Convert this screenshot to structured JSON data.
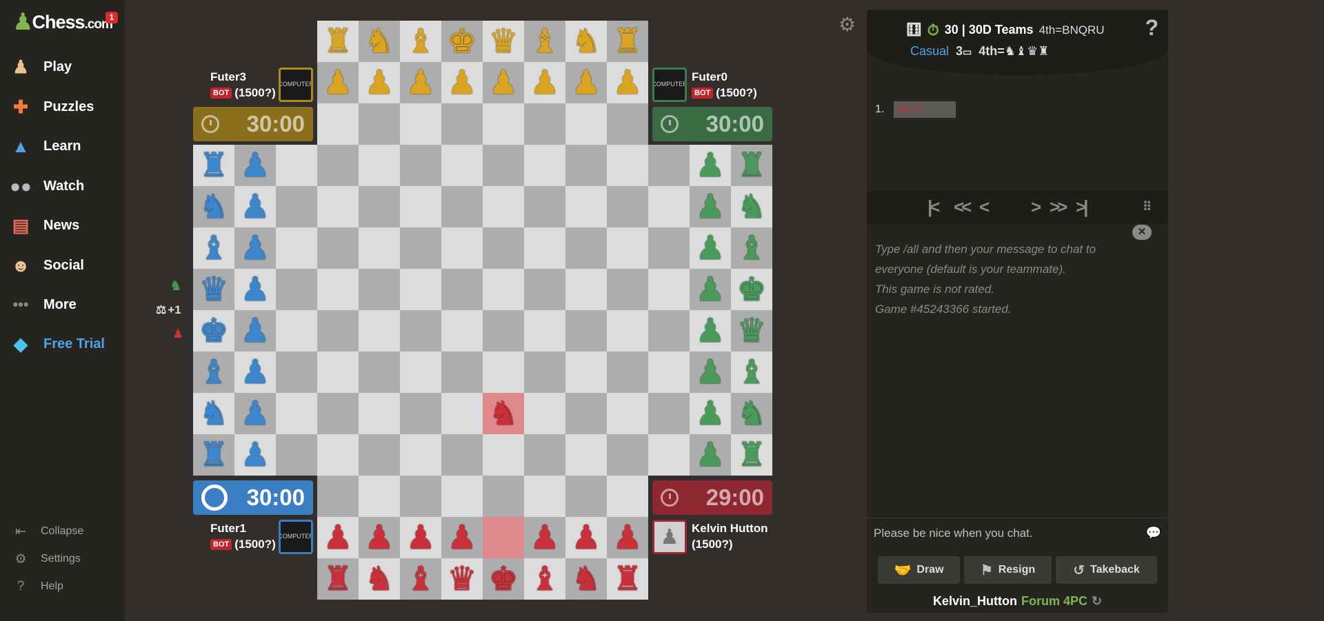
{
  "sidebar": {
    "logo_text": "Chess",
    "logo_suffix": ".com",
    "notification_count": "1",
    "nav": [
      {
        "label": "Play",
        "icon": "play-pawn-icon"
      },
      {
        "label": "Puzzles",
        "icon": "puzzle-icon"
      },
      {
        "label": "Learn",
        "icon": "graduation-cap-icon"
      },
      {
        "label": "Watch",
        "icon": "binoculars-icon"
      },
      {
        "label": "News",
        "icon": "newspaper-icon"
      },
      {
        "label": "Social",
        "icon": "people-icon"
      },
      {
        "label": "More",
        "icon": "more-dots-icon"
      },
      {
        "label": "Free Trial",
        "icon": "diamond-icon"
      }
    ],
    "footer": [
      {
        "label": "Collapse",
        "icon": "collapse-icon"
      },
      {
        "label": "Settings",
        "icon": "gear-icon"
      },
      {
        "label": "Help",
        "icon": "help-icon"
      }
    ]
  },
  "players": {
    "yellow": {
      "name": "Futer3",
      "badge": "BOT",
      "rating": "(1500?)",
      "clock": "30:00",
      "color": "#b08a1c",
      "avatar_text": "COMPUTER"
    },
    "green": {
      "name": "Futer0",
      "badge": "BOT",
      "rating": "(1500?)",
      "clock": "30:00",
      "color": "#3f7a4a",
      "avatar_text": "COMPUTER"
    },
    "blue": {
      "name": "Futer1",
      "badge": "BOT",
      "rating": "(1500?)",
      "clock": "30:00",
      "color": "#3a7fc4",
      "avatar_text": "COMPUTER"
    },
    "red": {
      "name": "Kelvin Hutton",
      "rating": "(1500?)",
      "clock": "29:00",
      "color": "#9e2830"
    }
  },
  "side_indicators": {
    "material": "+1"
  },
  "board": {
    "light_color": "#dcdcdc",
    "dark_color": "#adadad",
    "highlight_color": "#e0898d",
    "highlight_squares": [
      [
        4,
        9
      ],
      [
        4,
        12
      ]
    ],
    "pieces": [
      {
        "c": 0,
        "r": 0,
        "t": "rook",
        "side": "yellow"
      },
      {
        "c": 1,
        "r": 0,
        "t": "knight",
        "side": "yellow"
      },
      {
        "c": 2,
        "r": 0,
        "t": "bishop",
        "side": "yellow"
      },
      {
        "c": 3,
        "r": 0,
        "t": "king",
        "side": "yellow"
      },
      {
        "c": 4,
        "r": 0,
        "t": "queen",
        "side": "yellow"
      },
      {
        "c": 5,
        "r": 0,
        "t": "bishop",
        "side": "yellow"
      },
      {
        "c": 6,
        "r": 0,
        "t": "knight",
        "side": "yellow"
      },
      {
        "c": 7,
        "r": 0,
        "t": "rook",
        "side": "yellow"
      },
      {
        "c": 0,
        "r": 1,
        "t": "pawn",
        "side": "yellow"
      },
      {
        "c": 1,
        "r": 1,
        "t": "pawn",
        "side": "yellow"
      },
      {
        "c": 2,
        "r": 1,
        "t": "pawn",
        "side": "yellow"
      },
      {
        "c": 3,
        "r": 1,
        "t": "pawn",
        "side": "yellow"
      },
      {
        "c": 4,
        "r": 1,
        "t": "pawn",
        "side": "yellow"
      },
      {
        "c": 5,
        "r": 1,
        "t": "pawn",
        "side": "yellow"
      },
      {
        "c": 6,
        "r": 1,
        "t": "pawn",
        "side": "yellow"
      },
      {
        "c": 7,
        "r": 1,
        "t": "pawn",
        "side": "yellow"
      },
      {
        "c": -3,
        "r": 3,
        "t": "rook",
        "side": "blue"
      },
      {
        "c": -3,
        "r": 4,
        "t": "knight",
        "side": "blue"
      },
      {
        "c": -3,
        "r": 5,
        "t": "bishop",
        "side": "blue"
      },
      {
        "c": -3,
        "r": 6,
        "t": "queen",
        "side": "blue"
      },
      {
        "c": -3,
        "r": 7,
        "t": "king",
        "side": "blue"
      },
      {
        "c": -3,
        "r": 8,
        "t": "bishop",
        "side": "blue"
      },
      {
        "c": -3,
        "r": 9,
        "t": "knight",
        "side": "blue"
      },
      {
        "c": -3,
        "r": 10,
        "t": "rook",
        "side": "blue"
      },
      {
        "c": -2,
        "r": 3,
        "t": "pawn",
        "side": "blue"
      },
      {
        "c": -2,
        "r": 4,
        "t": "pawn",
        "side": "blue"
      },
      {
        "c": -2,
        "r": 5,
        "t": "pawn",
        "side": "blue"
      },
      {
        "c": -2,
        "r": 6,
        "t": "pawn",
        "side": "blue"
      },
      {
        "c": -2,
        "r": 7,
        "t": "pawn",
        "side": "blue"
      },
      {
        "c": -2,
        "r": 8,
        "t": "pawn",
        "side": "blue"
      },
      {
        "c": -2,
        "r": 9,
        "t": "pawn",
        "side": "blue"
      },
      {
        "c": -2,
        "r": 10,
        "t": "pawn",
        "side": "blue"
      },
      {
        "c": 10,
        "r": 3,
        "t": "rook",
        "side": "green"
      },
      {
        "c": 10,
        "r": 4,
        "t": "knight",
        "side": "green"
      },
      {
        "c": 10,
        "r": 5,
        "t": "bishop",
        "side": "green"
      },
      {
        "c": 10,
        "r": 6,
        "t": "king",
        "side": "green"
      },
      {
        "c": 10,
        "r": 7,
        "t": "queen",
        "side": "green"
      },
      {
        "c": 10,
        "r": 8,
        "t": "bishop",
        "side": "green"
      },
      {
        "c": 10,
        "r": 9,
        "t": "knight",
        "side": "green"
      },
      {
        "c": 10,
        "r": 10,
        "t": "rook",
        "side": "green"
      },
      {
        "c": 9,
        "r": 3,
        "t": "pawn",
        "side": "green"
      },
      {
        "c": 9,
        "r": 4,
        "t": "pawn",
        "side": "green"
      },
      {
        "c": 9,
        "r": 5,
        "t": "pawn",
        "side": "green"
      },
      {
        "c": 9,
        "r": 6,
        "t": "pawn",
        "side": "green"
      },
      {
        "c": 9,
        "r": 7,
        "t": "pawn",
        "side": "green"
      },
      {
        "c": 9,
        "r": 8,
        "t": "pawn",
        "side": "green"
      },
      {
        "c": 9,
        "r": 9,
        "t": "pawn",
        "side": "green"
      },
      {
        "c": 9,
        "r": 10,
        "t": "pawn",
        "side": "green"
      },
      {
        "c": 4,
        "r": 9,
        "t": "knight",
        "side": "red"
      },
      {
        "c": 0,
        "r": 12,
        "t": "pawn",
        "side": "red"
      },
      {
        "c": 1,
        "r": 12,
        "t": "pawn",
        "side": "red"
      },
      {
        "c": 2,
        "r": 12,
        "t": "pawn",
        "side": "red"
      },
      {
        "c": 3,
        "r": 12,
        "t": "pawn",
        "side": "red"
      },
      {
        "c": 5,
        "r": 12,
        "t": "pawn",
        "side": "red"
      },
      {
        "c": 6,
        "r": 12,
        "t": "pawn",
        "side": "red"
      },
      {
        "c": 7,
        "r": 12,
        "t": "pawn",
        "side": "red"
      },
      {
        "c": 0,
        "r": 13,
        "t": "rook",
        "side": "red"
      },
      {
        "c": 1,
        "r": 13,
        "t": "knight",
        "side": "red"
      },
      {
        "c": 2,
        "r": 13,
        "t": "bishop",
        "side": "red"
      },
      {
        "c": 3,
        "r": 13,
        "t": "queen",
        "side": "red"
      },
      {
        "c": 4,
        "r": 13,
        "t": "king",
        "side": "red"
      },
      {
        "c": 5,
        "r": 13,
        "t": "bishop",
        "side": "red"
      },
      {
        "c": 6,
        "r": 13,
        "t": "knight",
        "side": "red"
      },
      {
        "c": 7,
        "r": 13,
        "t": "rook",
        "side": "red"
      }
    ]
  },
  "panel": {
    "game_mode": "30 | 30D Teams",
    "fourth_rule": "4th=BNQRU",
    "type": "Casual",
    "count": "3",
    "fourth_label": "4th=",
    "move_number": "1.",
    "move_text": "h4=U",
    "chat_lines": [
      "Type /all and then your message to chat to",
      "everyone (default is your teammate).",
      "This game is not rated.",
      "Game #45243366 started."
    ],
    "chat_placeholder": "Please be nice when you chat.",
    "buttons": {
      "draw": "Draw",
      "resign": "Resign",
      "takeback": "Takeback"
    },
    "footer_user": "Kelvin_Hutton",
    "footer_link": "Forum 4PC"
  }
}
